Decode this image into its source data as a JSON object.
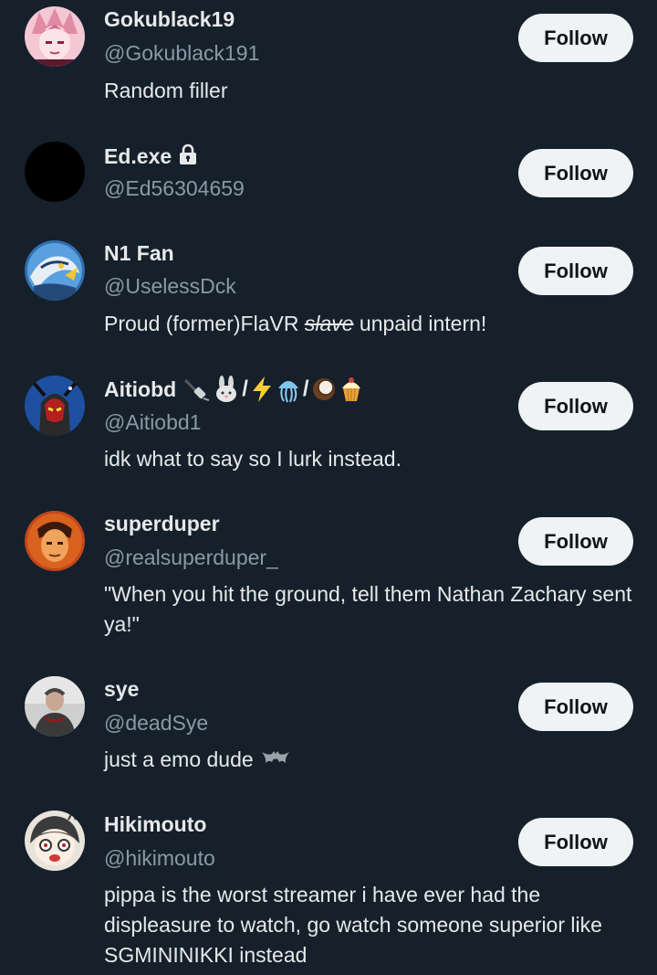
{
  "follow_label": "Follow",
  "accounts": [
    {
      "name": "Gokublack19",
      "handle": "@Gokublack191",
      "bio": "Random filler",
      "avatar": "pink-anime-avatar"
    },
    {
      "name": "Ed.exe",
      "handle": "@Ed56304659",
      "bio": "",
      "avatar": "black-avatar",
      "badge": "lock-icon"
    },
    {
      "name": "N1 Fan",
      "handle": "@UselessDck",
      "bio_pre": "Proud (former)FlaVR ",
      "bio_strike": "slave",
      "bio_post": " unpaid intern!",
      "avatar": "blue-creature-avatar"
    },
    {
      "name": "Aitiobd",
      "handle": "@Aitiobd1",
      "bio": "idk what to say so I lurk instead.",
      "avatar": "mecha-avatar",
      "name_emojis": [
        "plug-icon",
        "rabbit-icon",
        "lightning-icon",
        "jellyfish-icon",
        "coconut-icon",
        "cupcake-icon"
      ],
      "separator": "/"
    },
    {
      "name": "superduper",
      "handle": "@realsuperduper_",
      "bio": "\"When you hit the ground, tell them Nathan Zachary sent ya!\"",
      "avatar": "orange-face-avatar"
    },
    {
      "name": "sye",
      "handle": "@deadSye",
      "bio": "just a emo dude",
      "avatar": "photo-avatar",
      "bio_emoji": "bat-icon"
    },
    {
      "name": "Hikimouto",
      "handle": "@hikimouto",
      "bio": "pippa is the worst streamer i have ever had the displeasure to watch, go watch someone superior like SGMININIKKI instead",
      "avatar": "chibi-avatar"
    }
  ]
}
